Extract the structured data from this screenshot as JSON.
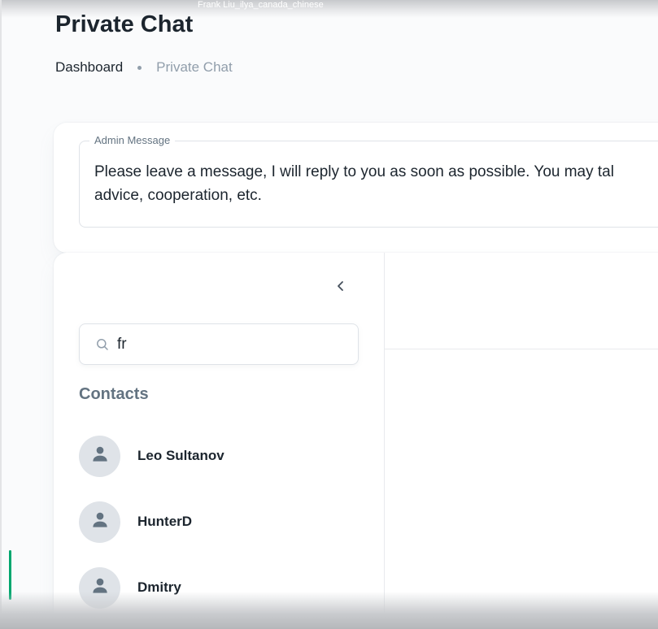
{
  "window": {
    "title": "Frank Liu_ilya_canada_chinese"
  },
  "page": {
    "title": "Private Chat"
  },
  "breadcrumb": {
    "items": [
      {
        "label": "Dashboard"
      },
      {
        "label": "Private Chat"
      }
    ]
  },
  "admin_message": {
    "legend": "Admin Message",
    "text": "Please leave a message, I will reply to you as soon as possible. You may tal\nadvice, cooperation, etc."
  },
  "contacts_panel": {
    "collapse_icon": "chevron-left-icon",
    "search": {
      "value": "fr",
      "icon": "search-icon"
    },
    "heading": "Contacts",
    "contacts": [
      {
        "name": "Leo Sultanov"
      },
      {
        "name": "HunterD"
      },
      {
        "name": "Dmitry"
      }
    ]
  },
  "colors": {
    "accent": "#00a76f",
    "text_primary": "#1c252e",
    "text_secondary": "#637381",
    "text_disabled": "#919eab",
    "avatar_bg": "#dfe3e8",
    "avatar_fg": "#637381"
  }
}
